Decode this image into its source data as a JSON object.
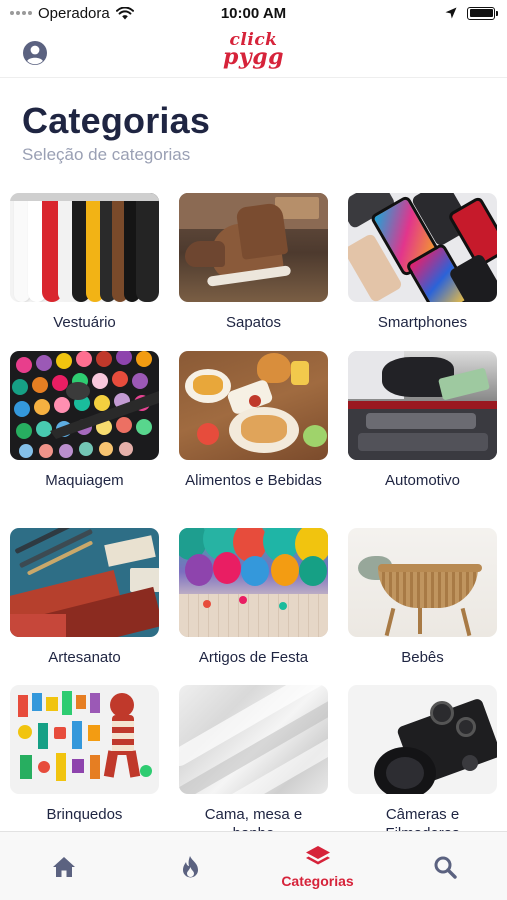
{
  "status_bar": {
    "carrier": "Operadora",
    "time": "10:00 AM",
    "battery_level": 1.0
  },
  "nav": {
    "logo_line1": "click",
    "logo_line2": "pygg",
    "profile_icon": "user-circle-icon",
    "accent_color": "#d6233a"
  },
  "header": {
    "title": "Categorias",
    "subtitle": "Seleção de categorias"
  },
  "categories": [
    {
      "label": "Vestuário"
    },
    {
      "label": "Sapatos"
    },
    {
      "label": "Smartphones"
    },
    {
      "label": "Maquiagem"
    },
    {
      "label": "Alimentos e Bebidas"
    },
    {
      "label": "Automotivo"
    },
    {
      "label": "Artesanato"
    },
    {
      "label": "Artigos de Festa"
    },
    {
      "label": "Bebês"
    },
    {
      "label": "Brinquedos"
    },
    {
      "label": "Cama, mesa e banho"
    },
    {
      "label": "Câmeras e Filmadoras"
    }
  ],
  "tab_bar": {
    "tabs": [
      {
        "icon": "home-icon",
        "label": "",
        "active": false
      },
      {
        "icon": "flame-icon",
        "label": "",
        "active": false
      },
      {
        "icon": "layers-icon",
        "label": "Categorias",
        "active": true
      },
      {
        "icon": "search-icon",
        "label": "",
        "active": false
      }
    ],
    "active_color": "#d6233a",
    "inactive_color": "#5b6280"
  }
}
